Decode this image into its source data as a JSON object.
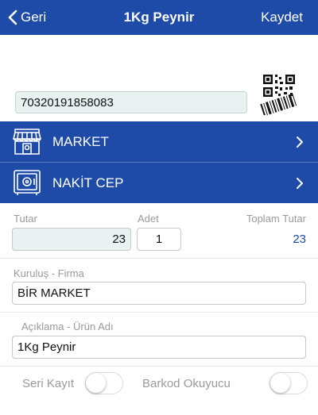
{
  "nav": {
    "back_label": "Geri",
    "title": "1Kg Peynir",
    "save_label": "Kaydet"
  },
  "barcode": {
    "value": "70320191858083"
  },
  "store_row": {
    "label": "MARKET"
  },
  "cash_row": {
    "label": "NAKİT CEP"
  },
  "amounts": {
    "amount_label": "Tutar",
    "amount_value": "23",
    "qty_label": "Adet",
    "qty_value": "1",
    "total_label": "Toplam Tutar",
    "total_value": "23"
  },
  "company": {
    "label": "Kuruluş - Firma",
    "value": "BİR MARKET"
  },
  "description": {
    "label": "Açıklama - Ürün Adı",
    "value": "1Kg Peynir"
  },
  "switches": {
    "serial_label": "Seri Kayıt",
    "serial_on": false,
    "barcode_label": "Barkod Okuyucu",
    "barcode_on": false
  },
  "colors": {
    "primary": "#1e4aa8",
    "input_fill": "#e9f1f1"
  }
}
